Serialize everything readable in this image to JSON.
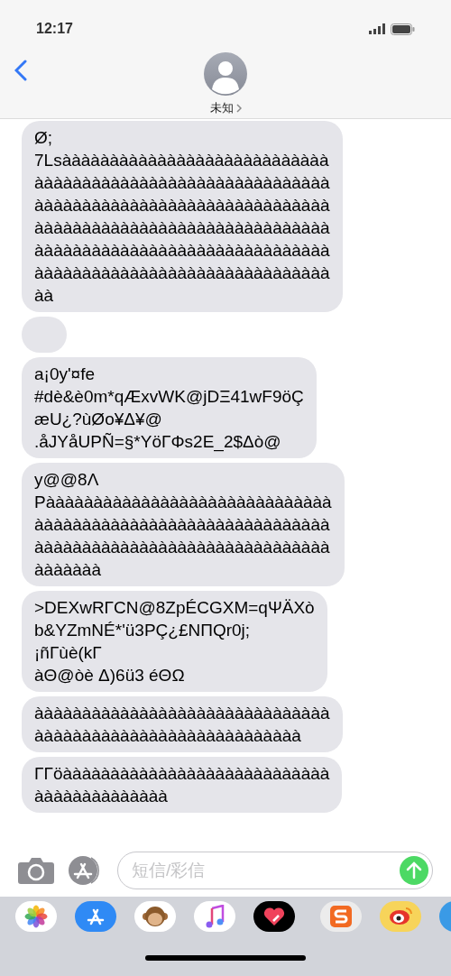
{
  "status_bar": {
    "time": "12:17"
  },
  "contact": {
    "name": "未知"
  },
  "messages": [
    {
      "kind": "text",
      "lines": [
        "Ø;",
        "7Lsàààààààààààààààààààààààààààà",
        "ààààààààààààààààààààààààààààààà",
        "ààààààààààààààààààààààààààààààà",
        "ààààààààààààààààààààààààààààààà",
        "ààààààààààààààààààààààààààààààà",
        "ààààààààààààààààààààààààààààààà",
        "àà"
      ]
    },
    {
      "kind": "empty"
    },
    {
      "kind": "text",
      "lines": [
        "a¡0y'¤fe",
        "#dè&è0m*qÆxvWK@jDΞ41wF9öÇ",
        "æU¿?ùØo¥Δ¥@",
        ".åJYåUPÑ=§*YöΓΦs2E_2$Δò@"
      ]
    },
    {
      "kind": "text",
      "lines": [
        "y@@8Λ",
        "Pàààààààààààààààààààààààààààààà",
        "ààààààààààààààààààààààààààààààà",
        "ààààààààààààààààààààààààààààààà",
        "ààààààà"
      ]
    },
    {
      "kind": "text",
      "lines": [
        ">DEXwRΓCN@8ZpÉCGXM=qΨÄXò",
        "b&YZmNÉ*'ü3PÇ¿£NΠQr0j;",
        "¡ñΓùè(kΓ",
        "àΘ@òè Δ)6ü3 éΘΩ"
      ]
    },
    {
      "kind": "text",
      "lines": [
        "ààààààààààààààààààààààààààààààà",
        "àààààààààààààààààààààààààààà"
      ]
    },
    {
      "kind": "text",
      "lines": [
        "ΓΓöàààààààààààààààààààààààààààà",
        "àààààààààààààà"
      ]
    }
  ],
  "compose": {
    "placeholder": "短信/彩信"
  }
}
